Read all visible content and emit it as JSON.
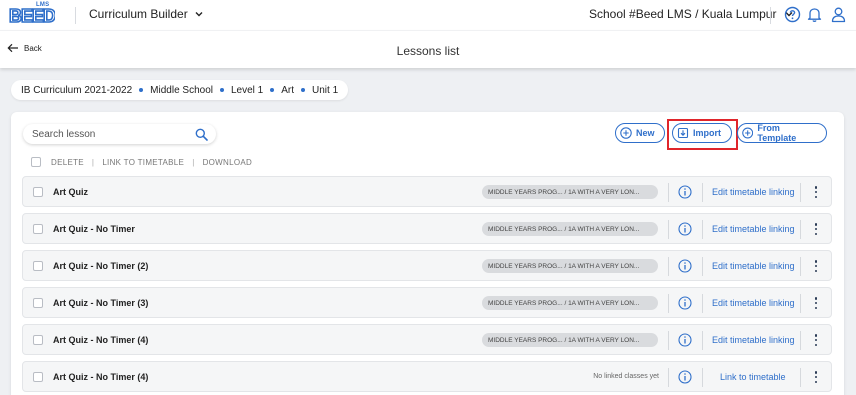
{
  "brand": {
    "logo_text": "BEED",
    "logo_sub": "LMS",
    "color": "#2f6fca"
  },
  "header": {
    "app_name": "Curriculum Builder",
    "school": "School #Beed LMS / Kuala Lumpur",
    "icons": [
      "help-icon",
      "bell-icon",
      "user-icon"
    ]
  },
  "subheader": {
    "back_label": "Back",
    "title": "Lessons list"
  },
  "breadcrumb": [
    "IB Curriculum 2021-2022",
    "Middle School",
    "Level 1",
    "Art",
    "Unit 1"
  ],
  "toolbar": {
    "search_placeholder": "Search lesson",
    "new_label": "New",
    "import_label": "Import",
    "template_label": "From Template"
  },
  "bulk_actions": [
    "DELETE",
    "LINK TO TIMETABLE",
    "DOWNLOAD"
  ],
  "lessons": [
    {
      "title": "Art Quiz",
      "tag": "MIDDLE YEARS PROG... / 1A WITH A VERY LON...",
      "action": "Edit timetable linking"
    },
    {
      "title": "Art Quiz - No Timer",
      "tag": "MIDDLE YEARS PROG... / 1A WITH A VERY LON...",
      "action": "Edit timetable linking"
    },
    {
      "title": "Art Quiz - No Timer (2)",
      "tag": "MIDDLE YEARS PROG... / 1A WITH A VERY LON...",
      "action": "Edit timetable linking"
    },
    {
      "title": "Art Quiz - No Timer (3)",
      "tag": "MIDDLE YEARS PROG... / 1A WITH A VERY LON...",
      "action": "Edit timetable linking"
    },
    {
      "title": "Art Quiz - No Timer (4)",
      "tag": "MIDDLE YEARS PROG... / 1A WITH A VERY LON...",
      "action": "Edit timetable linking"
    },
    {
      "title": "Art Quiz - No Timer (4)",
      "tag": "",
      "no_link_text": "No linked classes yet",
      "action": "Link to timetable"
    }
  ]
}
